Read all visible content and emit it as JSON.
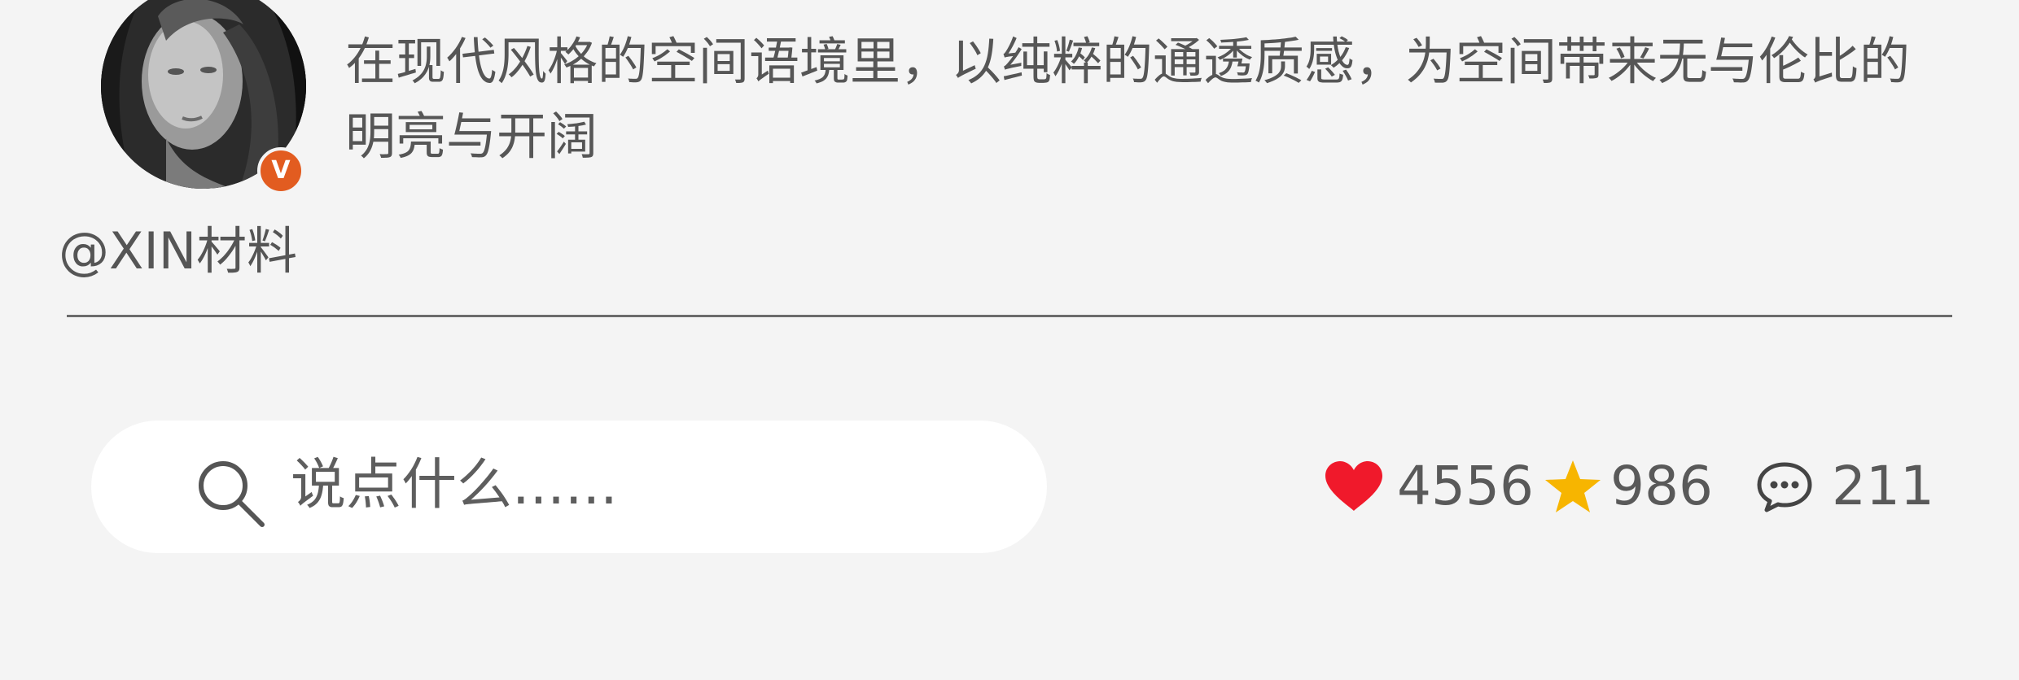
{
  "post": {
    "author": "@XIN材料",
    "verified_badge": "V",
    "text": "在现代风格的空间语境里，以纯粹的通透质感，为空间带来无与伦比的明亮与开阔"
  },
  "comment_bar": {
    "placeholder": "说点什么......",
    "icon": "search-icon"
  },
  "stats": {
    "likes": "4556",
    "favorites": "986",
    "comments": "211"
  },
  "colors": {
    "background": "#f4f4f4",
    "like": "#f0192b",
    "favorite": "#f7b500",
    "badge": "#e25c20"
  }
}
